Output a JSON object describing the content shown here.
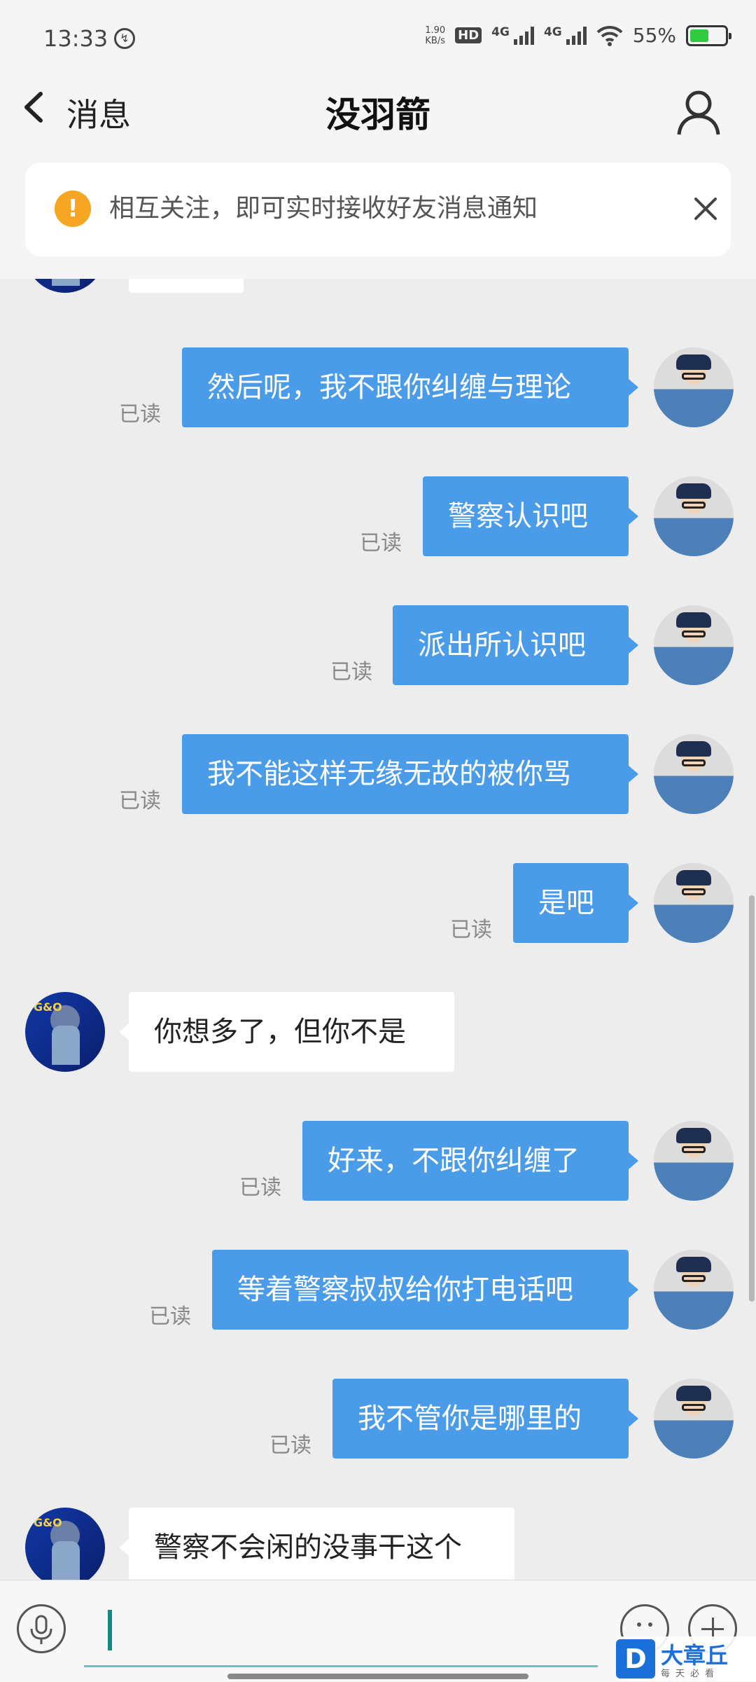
{
  "status_bar": {
    "time": "13:33",
    "vpn_symbol": "↯",
    "speed_top": "1.90",
    "speed_bottom": "KB/s",
    "hd_label": "HD",
    "sim1_label": "4G",
    "sim2_label": "4G",
    "battery": "55%",
    "battery_level": 0.55
  },
  "header": {
    "back_label": "消息",
    "title": "没羽箭"
  },
  "notice": {
    "icon": "warning-icon",
    "text": "相互关注，即可实时接收好友消息通知"
  },
  "colors": {
    "outgoing_bubble": "#4a9be8",
    "incoming_bubble": "#ffffff",
    "background": "#ededed",
    "warning": "#f6a623"
  },
  "messages": [
    {
      "from": "other",
      "text": ""
    },
    {
      "from": "me",
      "text": "然后呢，我不跟你纠缠与理论",
      "status": "已读"
    },
    {
      "from": "me",
      "text": "警察认识吧",
      "status": "已读"
    },
    {
      "from": "me",
      "text": "派出所认识吧",
      "status": "已读"
    },
    {
      "from": "me",
      "text": "我不能这样无缘无故的被你骂",
      "status": "已读"
    },
    {
      "from": "me",
      "text": "是吧",
      "status": "已读"
    },
    {
      "from": "other",
      "text": "你想多了，但你不是"
    },
    {
      "from": "me",
      "text": "好来，不跟你纠缠了",
      "status": "已读"
    },
    {
      "from": "me",
      "text": "等着警察叔叔给你打电话吧",
      "status": "已读"
    },
    {
      "from": "me",
      "text": "我不管你是哪里的",
      "status": "已读"
    },
    {
      "from": "other",
      "text": "警察不会闲的没事干这个"
    }
  ],
  "input": {
    "value": "",
    "placeholder": ""
  },
  "watermark": {
    "letter": "D",
    "name": "大章丘",
    "tagline": "每天必看"
  }
}
